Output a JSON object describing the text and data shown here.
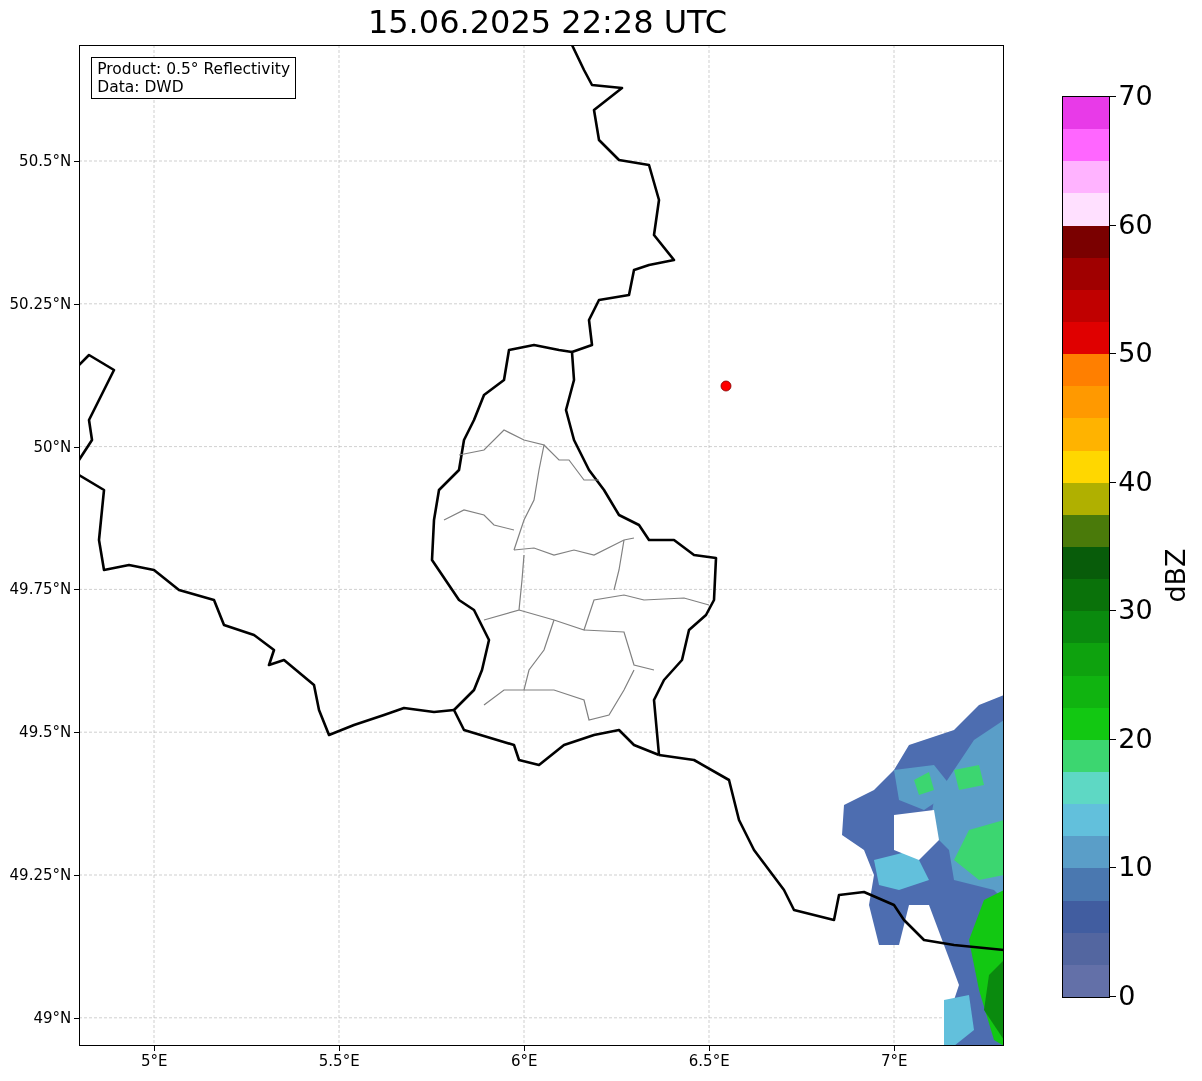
{
  "title": "15.06.2025 22:28 UTC",
  "info_box": {
    "lines": [
      "Product: 0.5° Reflectivity",
      "Data: DWD"
    ]
  },
  "map": {
    "latitude_ticks": [
      "50.5°N",
      "50.25°N",
      "50°N",
      "49.75°N",
      "49.5°N",
      "49.25°N",
      "49°N"
    ],
    "longitude_ticks": [
      "5°E",
      "5.5°E",
      "6°E",
      "6.5°E",
      "7°E"
    ]
  },
  "colorbar": {
    "label": "dBZ",
    "ticks": [
      "70",
      "60",
      "50",
      "40",
      "30",
      "20",
      "10",
      "0"
    ],
    "bands": [
      {
        "color": "#6370a8"
      },
      {
        "color": "#5366a0"
      },
      {
        "color": "#415da0"
      },
      {
        "color": "#4a78b0"
      },
      {
        "color": "#5a9ec8"
      },
      {
        "color": "#62c0dc"
      },
      {
        "color": "#5ed8c4"
      },
      {
        "color": "#3cd670"
      },
      {
        "color": "#12c812"
      },
      {
        "color": "#10b410"
      },
      {
        "color": "#0ea20e"
      },
      {
        "color": "#0a8a0e"
      },
      {
        "color": "#0a720a"
      },
      {
        "color": "#085c0a"
      },
      {
        "color": "#4a7a0a"
      },
      {
        "color": "#b0b000"
      },
      {
        "color": "#ffd700"
      },
      {
        "color": "#ffb300"
      },
      {
        "color": "#ff9900"
      },
      {
        "color": "#ff7f00"
      },
      {
        "color": "#e00000"
      },
      {
        "color": "#c00000"
      },
      {
        "color": "#a00000"
      },
      {
        "color": "#7a0000"
      },
      {
        "color": "#ffe0ff"
      },
      {
        "color": "#ffb3ff"
      },
      {
        "color": "#ff66ff"
      },
      {
        "color": "#e83ae8"
      }
    ]
  }
}
